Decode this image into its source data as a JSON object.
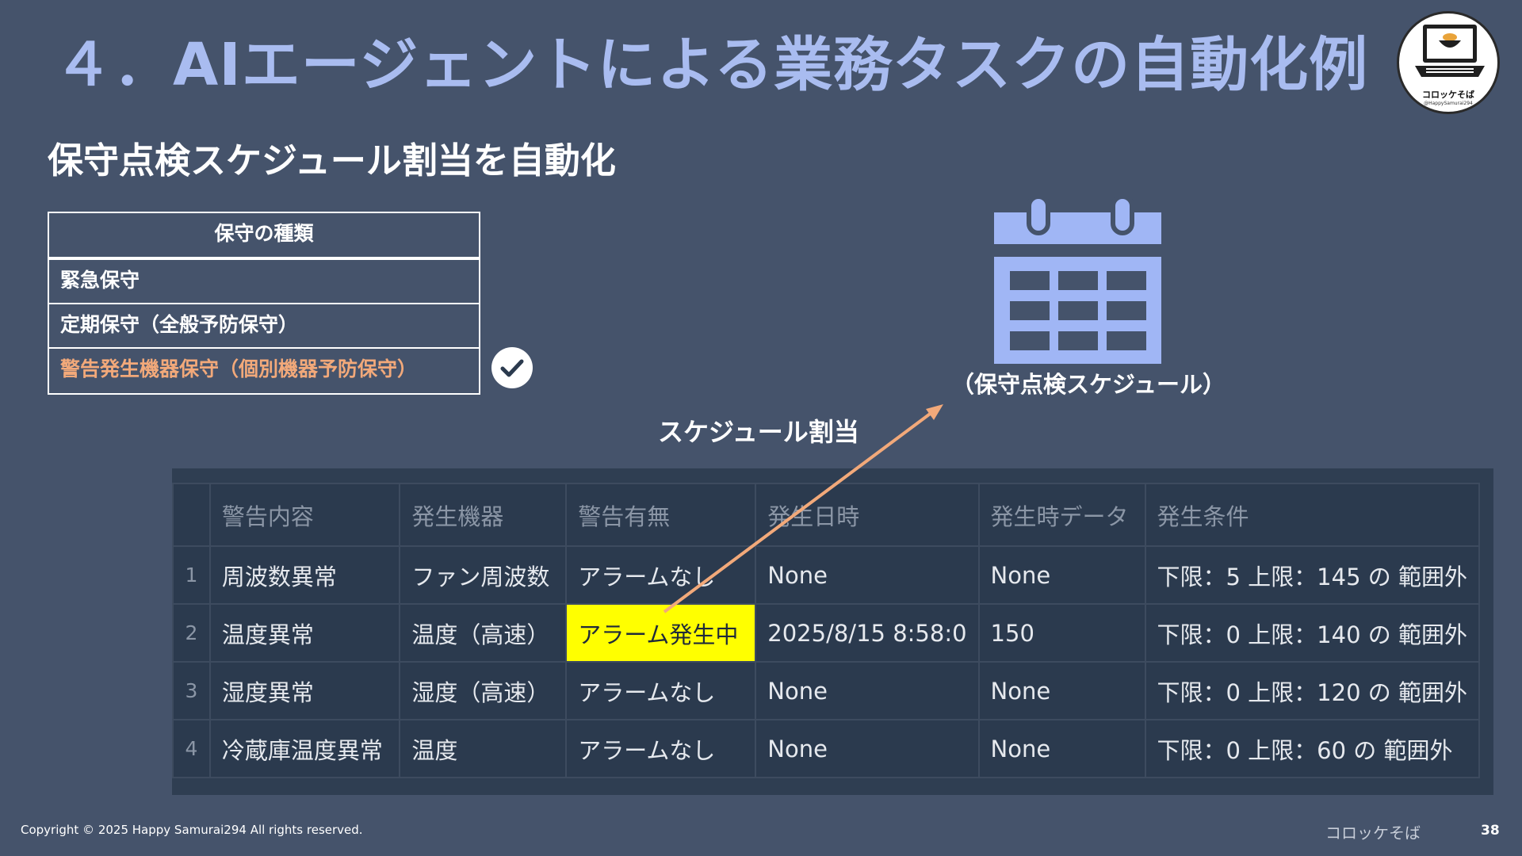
{
  "slide": {
    "title": "４．AIエージェントによる業務タスクの自動化例",
    "subtitle": "保守点検スケジュール割当を自動化"
  },
  "logo": {
    "caption": "コロッケそば",
    "handle": "@HappySamurai294",
    "icon": "laptop-noodle-bowl-icon"
  },
  "maintenance_table": {
    "header": "保守の種類",
    "rows": [
      "緊急保守",
      "定期保守（全般予防保守）",
      "警告発生機器保守（個別機器予防保守）"
    ],
    "highlight_color": "#f2a97a"
  },
  "calendar": {
    "label": "（保守点検スケジュール）",
    "icon": "calendar-icon",
    "color": "#a0b6f5"
  },
  "arrow": {
    "label": "スケジュール割当",
    "color": "#f2a97a"
  },
  "alert_table": {
    "columns": [
      "",
      "警告内容",
      "発生機器",
      "警告有無",
      "発生日時",
      "発生時データ",
      "発生条件"
    ],
    "rows": [
      [
        "1",
        "周波数異常",
        "ファン周波数",
        "アラームなし",
        "None",
        "None",
        "下限：5 上限：145 の 範囲外"
      ],
      [
        "2",
        "温度異常",
        "温度（高速）",
        "アラーム発生中",
        "2025/8/15 8:58:0",
        "150",
        "下限：0 上限：140 の 範囲外"
      ],
      [
        "3",
        "湿度異常",
        "湿度（高速）",
        "アラームなし",
        "None",
        "None",
        "下限：0 上限：120 の 範囲外"
      ],
      [
        "4",
        "冷蔵庫温度異常",
        "温度",
        "アラームなし",
        "None",
        "None",
        "下限：0 上限：60 の 範囲外"
      ]
    ],
    "alarm_highlight_color": "#ffff00"
  },
  "footer": {
    "copyright": "Copyright © 2025 Happy Samurai294 All rights reserved.",
    "brand": "コロッケそば",
    "page": "38"
  },
  "colors": {
    "background": "#45536b",
    "title": "#a9bcf0",
    "table_bg": "#2b3a4e"
  }
}
